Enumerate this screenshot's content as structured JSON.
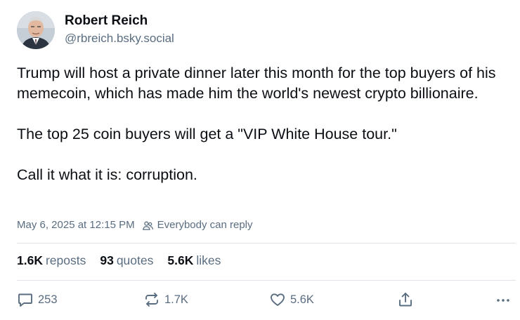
{
  "author": {
    "display_name": "Robert Reich",
    "handle": "@rbreich.bsky.social"
  },
  "post": {
    "paragraphs": [
      "Trump will host a private dinner later this month for the top buyers of his memecoin, which has made him the world's newest crypto billionaire.",
      "The top 25 coin buyers will get a \"VIP White House tour.\"",
      "Call it what it is: corruption."
    ],
    "timestamp": "May 6, 2025 at 12:15 PM",
    "reply_setting": "Everybody can reply"
  },
  "stats": {
    "reposts_count": "1.6K",
    "reposts_label": "reposts",
    "quotes_count": "93",
    "quotes_label": "quotes",
    "likes_count": "5.6K",
    "likes_label": "likes"
  },
  "actions": {
    "reply_count": "253",
    "repost_count": "1.7K",
    "like_count": "5.6K"
  },
  "icons": {
    "reply": "speech-bubble-icon",
    "repost": "repost-arrows-icon",
    "like": "heart-icon",
    "share": "share-upload-icon",
    "more": "ellipsis-icon",
    "reply_setting": "people-icon"
  },
  "colors": {
    "text_primary": "#0b0f14",
    "text_secondary": "#5a6d80",
    "divider": "#dfe4ea",
    "background": "#ffffff"
  }
}
